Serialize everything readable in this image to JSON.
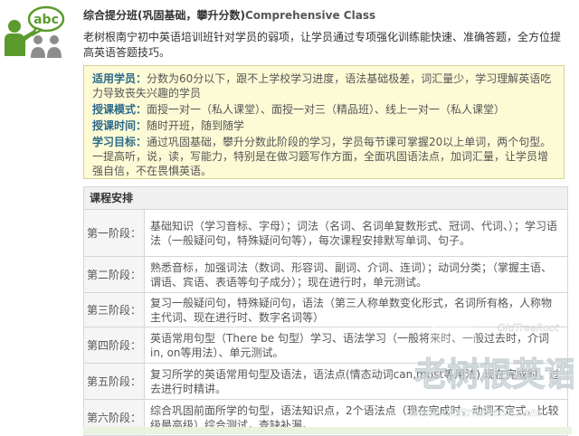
{
  "logo": {
    "bubble_text": "abc"
  },
  "header": {
    "title_cn": "综合提分班(巩固基础，攀升分数)",
    "title_en": "Comprehensive Class"
  },
  "intro": "老树根南宁初中英语培训班针对学员的弱项，让学员通过专项强化训练能快速、准确答题，全方位提高英语答题技巧。",
  "info": [
    {
      "label": "适用学员：",
      "text": "分数为60分以下，跟不上学校学习进度，语法基础极差，词汇量少，学习理解英语吃力导致丧失兴趣的学员"
    },
    {
      "label": "授课模式：",
      "text": "面授一对一（私人课堂）、面授一对三（精品班）、线上一对一（私人课堂）"
    },
    {
      "label": "授课时间：",
      "text": "随时开班，随到随学"
    },
    {
      "label": "学习目标：",
      "text": "通过巩固基础，攀升分数此阶段的学习，学员每节课可掌握20以上单词，两个句型。一提高听，说，读，写能力，特别是在做习题写作方面，全面巩固语法点，加词汇量，让学员增强自信，不在畏惧英语。"
    }
  ],
  "schedule": {
    "heading": "课程安排",
    "rows": [
      {
        "stage": "第一阶段：",
        "content": "基础知识（学习音标、字母）；词法（名词、名词单复数形式、冠词、代词、）；学习语法（一般疑问句，特殊疑问句等），每次课程安排默写单词、句子。"
      },
      {
        "stage": "第二阶段：",
        "content": "熟悉音标，加强词法（数词、形容词、副词、介词、连词）；动词分类；（掌握主语、谓语、宾语、表语等句子成分）；现在进行时，单元测试。"
      },
      {
        "stage": "第三阶段：",
        "content": "复习一般疑问句，特殊疑问句，语法（第三人称单数变化形式，名词所有格，人称物主代词、现在进行时、数字名词等）"
      },
      {
        "stage": "第四阶段：",
        "content": "英语常用句型（There be 句型）学习、语法学习（一般将来时、一般过去时，介词in, on等用法）、单元测试。"
      },
      {
        "stage": "第五阶段：",
        "content": "复习所学的英语常用句型及语法，语法点(情态动词can,must等用法) 现在完成时，过去进行时精讲。"
      },
      {
        "stage": "第六阶段：",
        "content": "综合巩固前面所学的句型，语法知识点，2个语法点（现在完成时，动词不定式，比较级最高级）综合测试，查缺补漏。"
      }
    ]
  },
  "watermark": {
    "main": "老树根英语",
    "en_small": "OldTreeRoot",
    "url": "www.oldtreeroot.com"
  },
  "colors": {
    "logo_green": "#5b9b2d",
    "logo_gray": "#8c8c8c",
    "label_blue": "#2d6a8a",
    "info_bg": "#fdfbd6",
    "info_border": "#d8d19a"
  }
}
